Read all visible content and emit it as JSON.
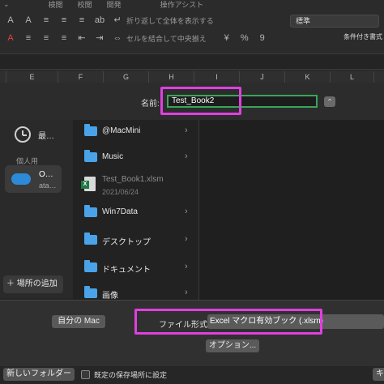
{
  "ribbon": {
    "row1_items": [
      "⌄",
      "検閲",
      "校閲",
      "開発",
      "操作アシスト"
    ],
    "wrap_text": "折り返して全体を表示する",
    "merge_center": "セルを結合して中央揃え",
    "number_format": "標準",
    "side_label": "条件付き書式",
    "percent": "%",
    "comma": "9"
  },
  "columns": [
    "E",
    "F",
    "G",
    "H",
    "I",
    "J",
    "K",
    "L"
  ],
  "dialog": {
    "name_label": "名前:",
    "filename": "Test_Book2",
    "expand_icon": "chevron-up-icon",
    "sidebar": {
      "recent_label": "最…",
      "section_personal": "個人用",
      "onedrive_title": "O…",
      "onedrive_sub": "ata…",
      "add_place": "＋ 場所の追加"
    },
    "files": [
      {
        "name": "@MacMini",
        "type": "folder",
        "chevron": "›"
      },
      {
        "name": "Music",
        "type": "folder",
        "chevron": "›"
      },
      {
        "name": "Test_Book1.xlsm",
        "type": "excel",
        "date": "2021/06/24"
      },
      {
        "name": "Win7Data",
        "type": "folder",
        "chevron": "›"
      },
      {
        "name": "デスクトップ",
        "type": "folder",
        "chevron": "›"
      },
      {
        "name": "ドキュメント",
        "type": "folder",
        "chevron": "›"
      },
      {
        "name": "画像",
        "type": "folder",
        "chevron": "›"
      }
    ],
    "my_mac": "自分の Mac",
    "format_label": "ファイル形式:",
    "format_value": "Excel マクロ有効ブック (.xlsm)",
    "options_button": "オプション...",
    "new_folder": "新しいフォルダー",
    "default_location": "既定の保存場所に設定",
    "cancel_fragment": "キ"
  },
  "colors": {
    "highlight": "#e040e0",
    "input_border": "#3aa55a",
    "folder": "#4aa3e8"
  }
}
